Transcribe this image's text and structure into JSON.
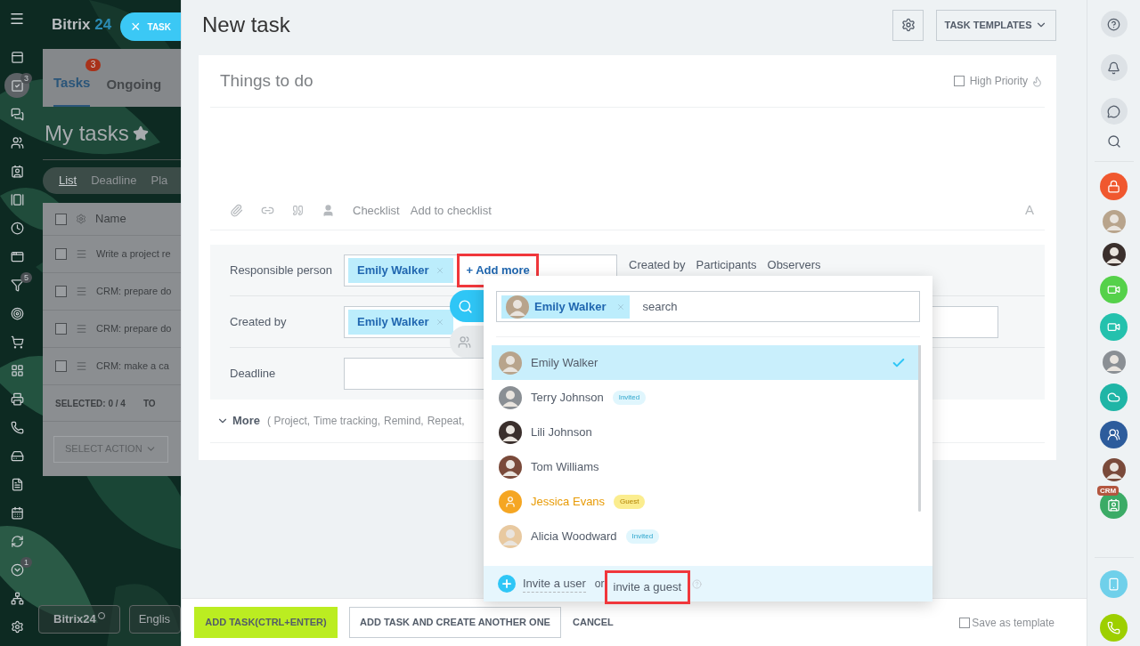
{
  "background": {
    "logo": {
      "name": "Bitrix",
      "number": "24"
    },
    "close_tab": {
      "icon": "×",
      "label": "TASK"
    },
    "menu": [
      {
        "selected": false
      },
      {
        "selected": true,
        "badge": "3"
      },
      {
        "selected": false
      },
      {
        "selected": false
      },
      {
        "selected": false
      },
      {
        "selected": false
      },
      {
        "selected": false
      },
      {
        "selected": false
      },
      {
        "selected": false,
        "badge": "5"
      },
      {
        "selected": false
      },
      {
        "selected": false
      },
      {
        "selected": false
      },
      {
        "selected": false
      },
      {
        "selected": false
      },
      {
        "selected": false
      },
      {
        "selected": false
      },
      {
        "selected": false
      },
      {
        "selected": false
      },
      {
        "selected": false,
        "badge": "1"
      },
      {
        "selected": false
      },
      {
        "selected": false
      }
    ],
    "tabs": [
      {
        "label": "Tasks",
        "count": "3",
        "selected": true
      },
      {
        "label": "Ongoing",
        "selected": false
      }
    ],
    "title": "My tasks",
    "views": [
      {
        "label": "List",
        "selected": true
      },
      {
        "label": "Deadline",
        "selected": false
      },
      {
        "label": "Pla",
        "selected": false
      }
    ],
    "table": {
      "column": "Name",
      "all_checked": false,
      "rows": [
        {
          "title": "Write a project re",
          "checked": false
        },
        {
          "title": "CRM: prepare do",
          "checked": false
        },
        {
          "title": "CRM: prepare do",
          "checked": false
        },
        {
          "title": "CRM: make a ca",
          "checked": false
        }
      ]
    },
    "summary": {
      "label": "SELECTED:",
      "value": "0 / 4",
      "next": "TO"
    },
    "action": "SELECT ACTION",
    "footer_buttons": [
      "Bitrix24",
      "Englis"
    ]
  },
  "task": {
    "title": "New task",
    "templates_button": "TASK TEMPLATES",
    "name_placeholder": "Things to do",
    "high_priority": {
      "label": "High Priority",
      "checked": false
    },
    "toolbar": [
      "Checklist",
      "Add to checklist"
    ],
    "font_button": "A",
    "fields": [
      {
        "label": "Responsible person",
        "people": [
          "Emily Walker"
        ],
        "add": "+ Add more"
      },
      {
        "label": "Created by",
        "people": [
          "Emily Walker"
        ]
      },
      {
        "label": "Deadline"
      }
    ],
    "roles": [
      "Created by",
      "Participants",
      "Observers"
    ],
    "more": {
      "label": "More",
      "items": [
        "( Project,",
        "Time tracking,",
        "Remind,",
        "Repeat,"
      ]
    }
  },
  "selector": {
    "chip": "Emily Walker",
    "search_placeholder": "search",
    "people": [
      {
        "name": "Emily Walker",
        "kind": "user",
        "selected": true
      },
      {
        "name": "Terry Johnson",
        "kind": "invited",
        "tag": "Invited",
        "selected": false
      },
      {
        "name": "Lili Johnson",
        "kind": "user",
        "selected": false
      },
      {
        "name": "Tom Williams",
        "kind": "user",
        "selected": false
      },
      {
        "name": "Jessica Evans",
        "kind": "guest",
        "tag": "Guest",
        "selected": false
      },
      {
        "name": "Alicia Woodward",
        "kind": "invited",
        "tag": "Invited",
        "selected": false
      }
    ],
    "invite_user": "Invite a user",
    "or": "or",
    "invite_guest": "invite a guest"
  },
  "footer": {
    "add": "ADD TASK(CTRL+ENTER)",
    "add_another": "ADD TASK AND CREATE ANOTHER ONE",
    "cancel": "CANCEL",
    "save_template": {
      "label": "Save as template",
      "checked": false
    }
  },
  "right_bar": {
    "crm_badge": "CRM"
  }
}
